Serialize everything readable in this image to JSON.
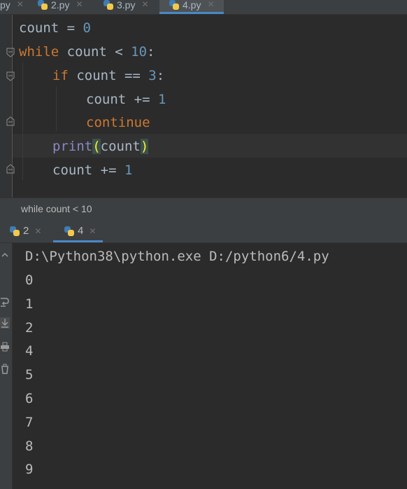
{
  "editor_tabs": [
    {
      "label": "py",
      "active": false
    },
    {
      "label": "2.py",
      "active": false
    },
    {
      "label": "3.py",
      "active": false
    },
    {
      "label": "4.py",
      "active": true
    }
  ],
  "code": {
    "l1": {
      "var": "count",
      "op": " = ",
      "num": "0"
    },
    "l2": {
      "kw": "while",
      "mid": " count < ",
      "num": "10",
      "end": ":"
    },
    "l3": {
      "kw": "if",
      "mid": " count == ",
      "num": "3",
      "end": ":"
    },
    "l4": {
      "mid": "count += ",
      "num": "1"
    },
    "l5": {
      "kw": "continue"
    },
    "l6": {
      "fn": "print",
      "open": "(",
      "arg": "count",
      "close": ")"
    },
    "l7": {
      "mid": "count += ",
      "num": "1"
    }
  },
  "breadcrumb": "while count < 10",
  "run_tabs": [
    {
      "label": "2",
      "active": false
    },
    {
      "label": "4",
      "active": true
    }
  ],
  "console": {
    "command": "D:\\Python38\\python.exe D:/python6/4.py",
    "output": [
      "0",
      "1",
      "2",
      "4",
      "5",
      "6",
      "7",
      "8",
      "9"
    ]
  },
  "colors": {
    "keyword": "#cc7832",
    "number": "#6897bb",
    "builtin": "#8888c6",
    "text": "#a9b7c6",
    "background": "#2b2b2b",
    "accent": "#4a88c7"
  }
}
